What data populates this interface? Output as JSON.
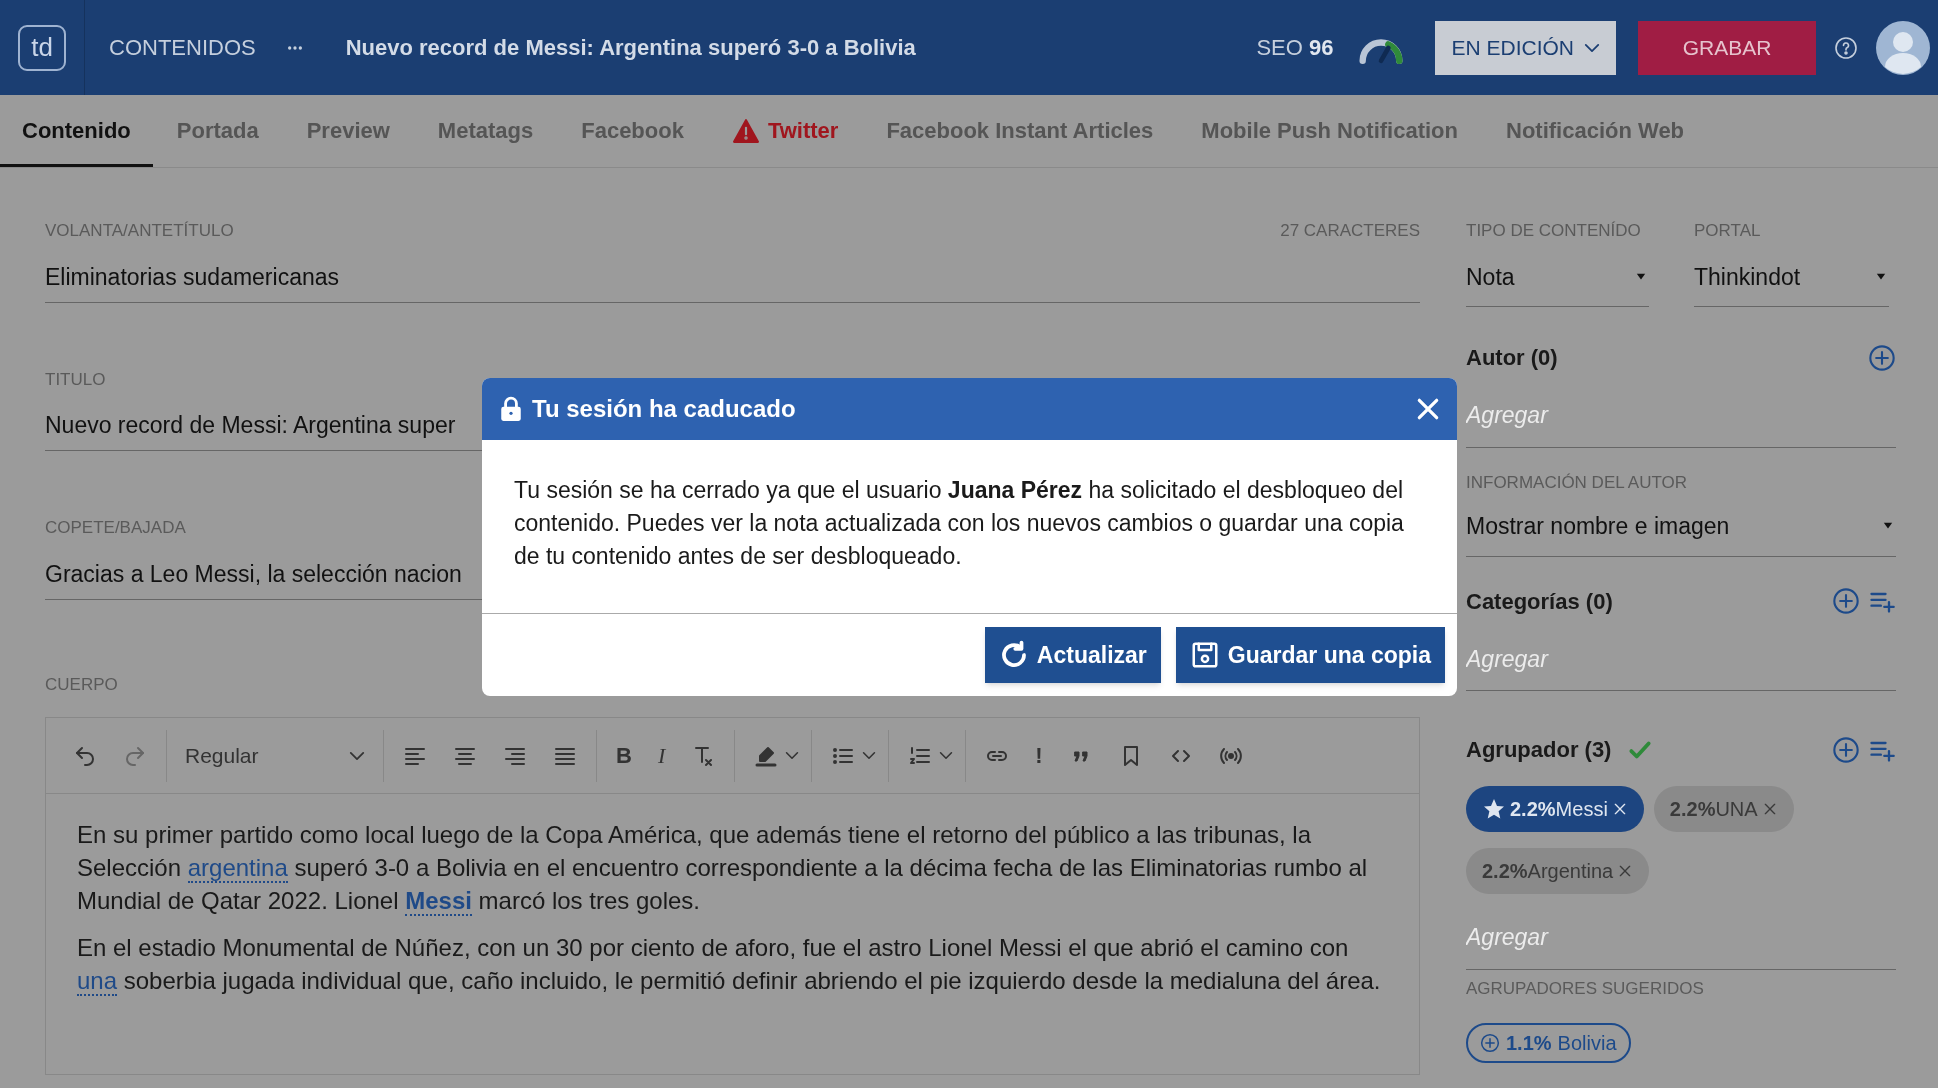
{
  "header": {
    "logo": "td",
    "section": "CONTENIDOS",
    "title": "Nuevo record de Messi: Argentina superó 3-0 a Bolivia",
    "seo_label": "SEO",
    "seo_score": "96",
    "status": "EN EDICIÓN",
    "save": "GRABAR"
  },
  "tabs": [
    {
      "label": "Contenido",
      "selected": true,
      "alert": false
    },
    {
      "label": "Portada",
      "selected": false,
      "alert": false
    },
    {
      "label": "Preview",
      "selected": false,
      "alert": false
    },
    {
      "label": "Metatags",
      "selected": false,
      "alert": false
    },
    {
      "label": "Facebook",
      "selected": false,
      "alert": false
    },
    {
      "label": "Twitter",
      "selected": false,
      "alert": true
    },
    {
      "label": "Facebook Instant Articles",
      "selected": false,
      "alert": false
    },
    {
      "label": "Mobile Push Notification",
      "selected": false,
      "alert": false
    },
    {
      "label": "Notificación Web",
      "selected": false,
      "alert": false
    }
  ],
  "fields": [
    {
      "label": "VOLANTA/ANTETÍTULO",
      "counter": "27 CARACTERES",
      "value": "Eliminatorias sudamericanas"
    },
    {
      "label": "TITULO",
      "value": "Nuevo record de Messi: Argentina super"
    },
    {
      "label": "COPETE/BAJADA",
      "value": "Gracias a Leo Messi, la selección nacion"
    }
  ],
  "body": {
    "label": "CUERPO",
    "toolbar": {
      "style": "Regular",
      "bold": "B",
      "italic": "I",
      "alert": "!"
    },
    "paragraphs": [
      [
        {
          "text": "En su primer partido como local luego de la Copa América, que además tiene el retorno del público a las tribunas, la Selección ",
          "link": false,
          "bold": false
        },
        {
          "text": "argentina",
          "link": true,
          "bold": false
        },
        {
          "text": " superó 3-0 a Bolivia en el encuentro correspondiente a la décima fecha de las Eliminatorias rumbo al Mundial de Qatar 2022. Lionel ",
          "link": false,
          "bold": false
        },
        {
          "text": "Messi",
          "link": true,
          "bold": true
        },
        {
          "text": " marcó los tres goles.",
          "link": false,
          "bold": false
        }
      ],
      [
        {
          "text": "En el estadio Monumental de Núñez, con un 30 por ciento de aforo, fue el astro Lionel Messi el que abrió el camino con ",
          "link": false,
          "bold": false
        },
        {
          "text": "una",
          "link": true,
          "bold": false
        },
        {
          "text": " soberbia jugada individual que, caño incluido, le permitió definir abriendo el pie izquierdo desde la medialuna del área.",
          "link": false,
          "bold": false
        }
      ]
    ]
  },
  "sidebar": {
    "content_type": {
      "label": "TIPO DE CONTENÍDO",
      "value": "Nota"
    },
    "portal": {
      "label": "PORTAL",
      "value": "Thinkindot"
    },
    "author": {
      "title": "Autor (0)",
      "placeholder": "Agregar"
    },
    "author_info": {
      "label": "INFORMACIÓN DEL AUTOR",
      "value": "Mostrar nombre e imagen"
    },
    "categories": {
      "title": "Categorías (0)",
      "placeholder": "Agregar"
    },
    "groupers": {
      "title": "Agrupador (3)",
      "valid": true,
      "tags": [
        {
          "percent": "2.2%",
          "label": "Messi",
          "featured": true
        },
        {
          "percent": "2.2%",
          "label": "UNA",
          "featured": false
        },
        {
          "percent": "2.2%",
          "label": "Argentina",
          "featured": false
        }
      ],
      "placeholder": "Agregar"
    },
    "suggested": {
      "label": "AGRUPADORES SUGERIDOS",
      "tags": [
        {
          "percent": "1.1%",
          "label": "Bolivia"
        }
      ]
    }
  },
  "modal": {
    "title": "Tu sesión ha caducado",
    "message": "Tu sesión se ha cerrado ya que el usuario **Juana Pérez** ha solicitado el desbloqueo del contenido. Puedes ver la nota actualizada con los nuevos cambios o guardar una copia de tu contenido antes de ser desbloqueado.",
    "buttons": [
      {
        "kind": "refresh",
        "label": "Actualizar"
      },
      {
        "kind": "save",
        "label": "Guardar una copia"
      }
    ]
  }
}
